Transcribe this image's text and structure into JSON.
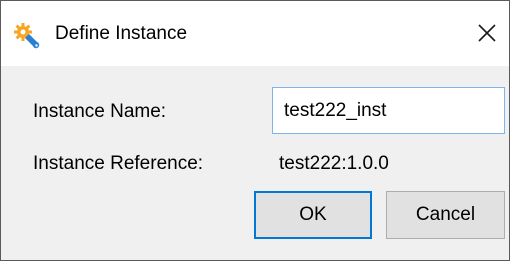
{
  "window": {
    "title": "Define Instance",
    "icon": "gear-wrench-icon",
    "close_icon": "close-icon"
  },
  "form": {
    "instance_name_label": "Instance Name:",
    "instance_name_value": "test222_inst",
    "instance_reference_label": "Instance Reference:",
    "instance_reference_value": "test222:1.0.0"
  },
  "buttons": {
    "ok_label": "OK",
    "cancel_label": "Cancel"
  },
  "colors": {
    "accent": "#0078d7",
    "input_focus_border": "#7eb4ea",
    "icon_blue": "#2a7fd4",
    "icon_orange": "#f5a623"
  }
}
